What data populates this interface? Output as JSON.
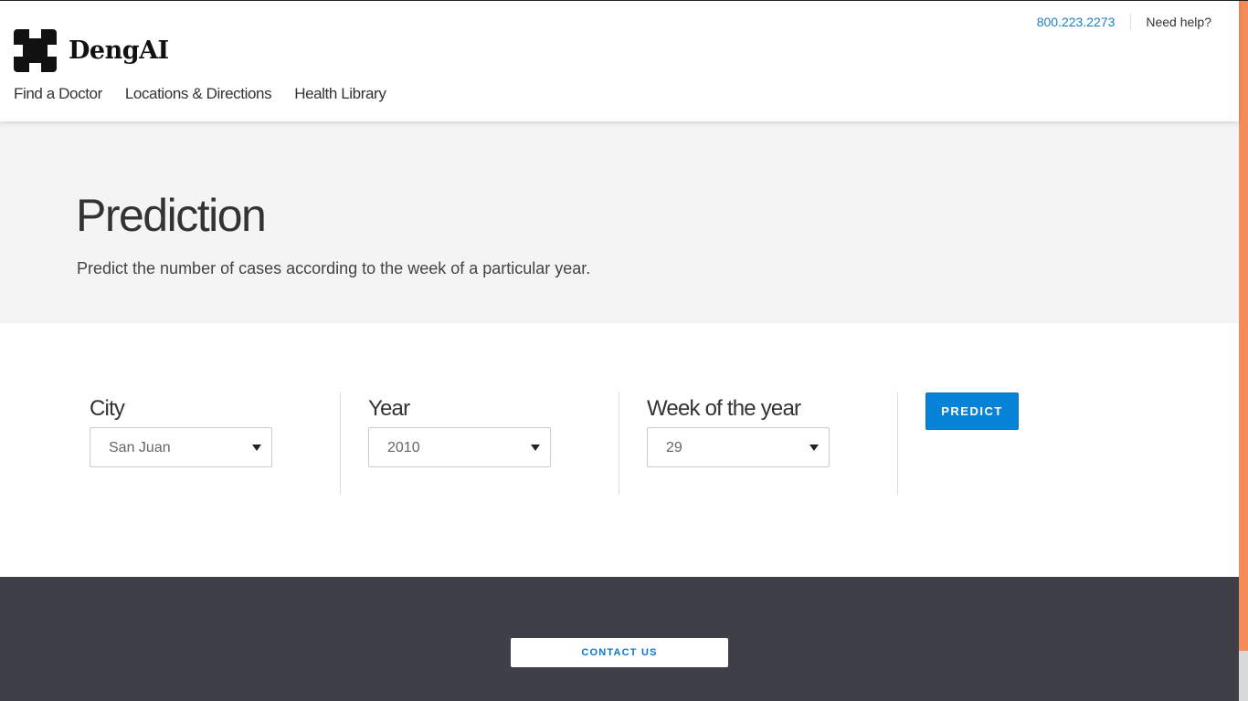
{
  "brand": {
    "name": "DengAI"
  },
  "top_links": {
    "phone": "800.223.2273",
    "help": "Need help?"
  },
  "nav": {
    "items": [
      {
        "label": "Find a Doctor"
      },
      {
        "label": "Locations & Directions"
      },
      {
        "label": "Health Library"
      }
    ]
  },
  "hero": {
    "title": "Prediction",
    "subtitle": "Predict the number of cases according to the week of a particular year."
  },
  "form": {
    "city": {
      "label": "City",
      "value": "San Juan"
    },
    "year": {
      "label": "Year",
      "value": "2010"
    },
    "week": {
      "label": "Week of the year",
      "value": "29"
    },
    "predict_label": "PREDICT"
  },
  "footer": {
    "contact_label": "CONTACT US"
  },
  "colors": {
    "accent": "#0683d6",
    "link": "#1b7fc4",
    "hero_bg": "#f4f4f4",
    "footer_bg": "#3e3f47",
    "scrollbar": "#f28c5a"
  }
}
